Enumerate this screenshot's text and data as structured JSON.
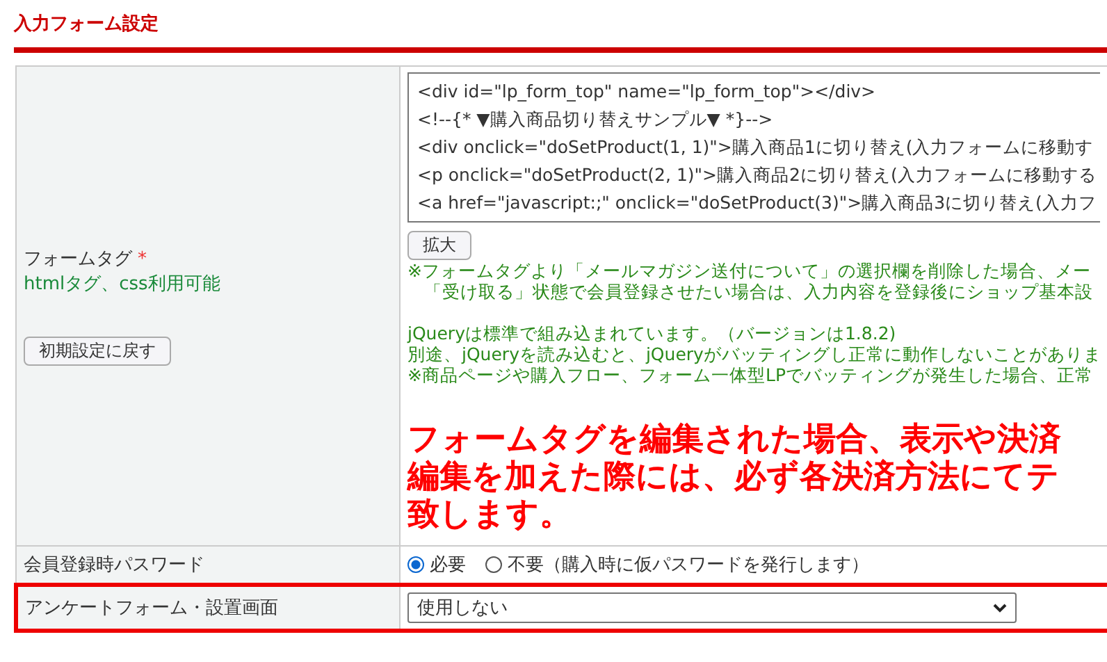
{
  "section_title": "入力フォーム設定",
  "rows": [
    {
      "kind": "code",
      "label": "フォームタグ",
      "required_mark": "*",
      "sublabel": "htmlタグ、css利用可能",
      "reset_button": "初期設定に戻す",
      "highlighted": false,
      "code_lines": [
        "<div id=\"lp_form_top\" name=\"lp_form_top\"></div>",
        "<!--{* ▼購入商品切り替えサンプル▼ *}-->",
        "<div onclick=\"doSetProduct(1, 1)\">購入商品1に切り替え(入力フォームに移動す",
        "<p onclick=\"doSetProduct(2, 1)\">購入商品2に切り替え(入力フォームに移動する",
        "<a href=\"javascript:;\" onclick=\"doSetProduct(3)\">購入商品3に切り替え(入力フ"
      ],
      "expand_button": "拡大",
      "notes": [
        "※フォームタグより「メールマガジン送付について」の選択欄を削除した場合、メー",
        "「受け取る」状態で会員登録させたい場合は、入力内容を登録後にショップ基本設"
      ],
      "jquery_notes": [
        "jQueryは標準で組み込まれています。（バージョンは1.8.2)",
        "別途、jQueryを読み込むと、jQueryがバッティングし正常に動作しないことがありま",
        "※商品ページや購入フロー、フォーム一体型LPでバッティングが発生した場合、正常"
      ],
      "warning_lines": [
        "フォームタグを編集された場合、表示や決済",
        "編集を加えた際には、必ず各決済方法にてテ",
        "致します。"
      ]
    },
    {
      "kind": "radio",
      "label": "会員登録時パスワード",
      "highlighted": false,
      "options": [
        {
          "label": "必要",
          "selected": true
        },
        {
          "label": "不要（購入時に仮パスワードを発行します）",
          "selected": false
        }
      ]
    },
    {
      "kind": "select",
      "label": "アンケートフォーム・設置画面",
      "highlighted": true,
      "value": "使用しない"
    }
  ]
}
